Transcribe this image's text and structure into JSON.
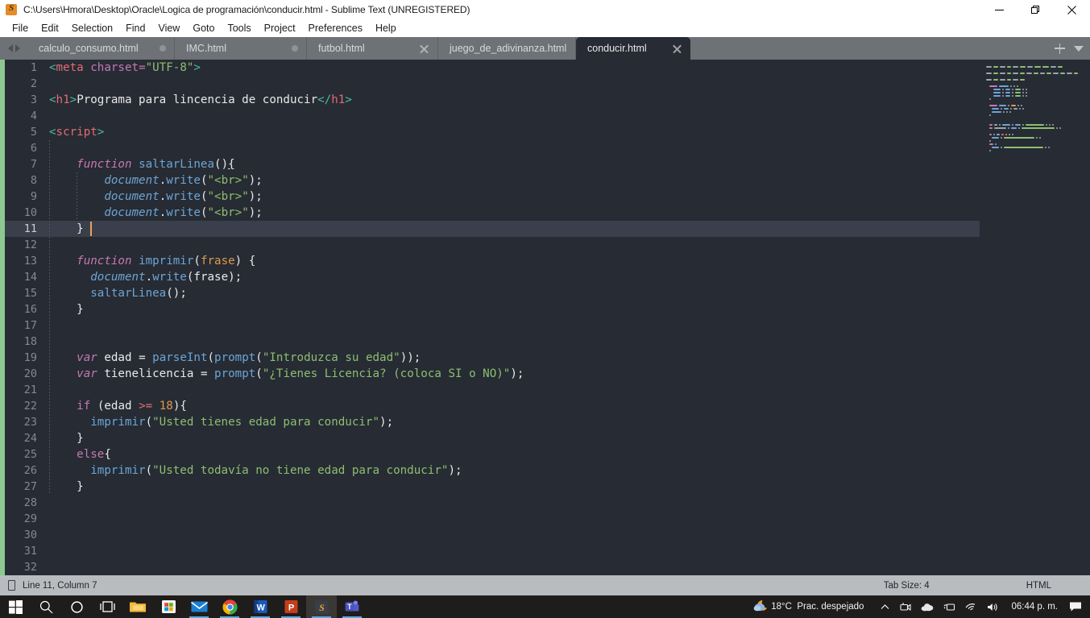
{
  "window": {
    "title": "C:\\Users\\Hmora\\Desktop\\Oracle\\Logica de programación\\conducir.html - Sublime Text (UNREGISTERED)",
    "app_icon": "sublime-text-icon",
    "minimize": "—",
    "restore": "restore-icon",
    "close": "✕"
  },
  "menubar": {
    "items": [
      {
        "label": "File"
      },
      {
        "label": "Edit"
      },
      {
        "label": "Selection"
      },
      {
        "label": "Find"
      },
      {
        "label": "View"
      },
      {
        "label": "Goto"
      },
      {
        "label": "Tools"
      },
      {
        "label": "Project"
      },
      {
        "label": "Preferences"
      },
      {
        "label": "Help"
      }
    ]
  },
  "tabbar": {
    "tabs": [
      {
        "label": "calculo_consumo.html",
        "active": false,
        "dirty": true
      },
      {
        "label": "IMC.html",
        "active": false,
        "dirty": true
      },
      {
        "label": "futbol.html",
        "active": false,
        "dirty": false
      },
      {
        "label": "juego_de_adivinanza.html",
        "active": false,
        "dirty": false
      },
      {
        "label": "conducir.html",
        "active": true,
        "dirty": false
      }
    ],
    "new_tab": "+",
    "overflow": "chevron-down-icon"
  },
  "editor": {
    "first_line": 1,
    "last_line": 32,
    "caret_line": 11,
    "caret_column": 7,
    "lines": [
      {
        "n": 1,
        "text": "<meta charset=\"UTF-8\">"
      },
      {
        "n": 2,
        "text": ""
      },
      {
        "n": 3,
        "text": "<h1>Programa para lincencia de conducir</h1>"
      },
      {
        "n": 4,
        "text": ""
      },
      {
        "n": 5,
        "text": "<script>"
      },
      {
        "n": 6,
        "text": ""
      },
      {
        "n": 7,
        "text": "    function saltarLinea(){"
      },
      {
        "n": 8,
        "text": "        document.write(\"<br>\");"
      },
      {
        "n": 9,
        "text": "        document.write(\"<br>\");"
      },
      {
        "n": 10,
        "text": "        document.write(\"<br>\");"
      },
      {
        "n": 11,
        "text": "    }"
      },
      {
        "n": 12,
        "text": ""
      },
      {
        "n": 13,
        "text": "    function imprimir(frase) {"
      },
      {
        "n": 14,
        "text": "      document.write(frase);"
      },
      {
        "n": 15,
        "text": "      saltarLinea();"
      },
      {
        "n": 16,
        "text": "    }"
      },
      {
        "n": 17,
        "text": ""
      },
      {
        "n": 18,
        "text": ""
      },
      {
        "n": 19,
        "text": "    var edad = parseInt(prompt(\"Introduzca su edad\"));"
      },
      {
        "n": 20,
        "text": "    var tienelicencia = prompt(\"¿Tienes Licencia? (coloca SI o NO)\");"
      },
      {
        "n": 21,
        "text": ""
      },
      {
        "n": 22,
        "text": "    if (edad >= 18){"
      },
      {
        "n": 23,
        "text": "      imprimir(\"Usted tienes edad para conducir\");"
      },
      {
        "n": 24,
        "text": "    }"
      },
      {
        "n": 25,
        "text": "    else{"
      },
      {
        "n": 26,
        "text": "      imprimir(\"Usted todavía no tiene edad para conducir\");"
      },
      {
        "n": 27,
        "text": "    }"
      },
      {
        "n": 28,
        "text": ""
      },
      {
        "n": 29,
        "text": ""
      },
      {
        "n": 30,
        "text": ""
      },
      {
        "n": 31,
        "text": ""
      },
      {
        "n": 32,
        "text": ""
      }
    ]
  },
  "statusbar": {
    "encoding_icon": "document-icon",
    "position": "Line 11, Column 7",
    "tab_size": "Tab Size: 4",
    "syntax": "HTML"
  },
  "taskbar": {
    "items": [
      {
        "name": "start-button",
        "icon": "windows-logo-icon"
      },
      {
        "name": "search-button",
        "icon": "search-icon"
      },
      {
        "name": "cortana-button",
        "icon": "cortana-circle-icon"
      },
      {
        "name": "task-view-button",
        "icon": "task-view-icon"
      },
      {
        "name": "file-explorer",
        "icon": "folder-icon"
      },
      {
        "name": "microsoft-store",
        "icon": "store-icon"
      },
      {
        "name": "mail",
        "icon": "mail-icon"
      },
      {
        "name": "google-chrome",
        "icon": "chrome-icon"
      },
      {
        "name": "microsoft-word",
        "icon": "word-icon"
      },
      {
        "name": "microsoft-powerpoint",
        "icon": "powerpoint-icon"
      },
      {
        "name": "sublime-text",
        "icon": "sublime-text-icon"
      },
      {
        "name": "microsoft-teams",
        "icon": "teams-icon"
      }
    ],
    "weather": {
      "icon": "partly-cloudy-night-icon",
      "temperature": "18°C",
      "condition": "Prac. despejado"
    },
    "tray": {
      "overflow": "chevron-up-icon",
      "icons": [
        "camera-icon",
        "onedrive-icon",
        "device-icon",
        "wifi-icon",
        "volume-icon"
      ]
    },
    "clock": "06:44 p. m.",
    "notifications": "action-center-icon"
  },
  "colors": {
    "editor_bg": "#272b33",
    "gutter_git": "#8dc891",
    "tabbar_bg": "#6e7277",
    "accent_caret": "#e9a15c",
    "string": "#8cbf73",
    "keyword": "#c678b6",
    "function": "#6ca5d6",
    "number": "#dd9a4d",
    "tag": "#e36b74"
  }
}
